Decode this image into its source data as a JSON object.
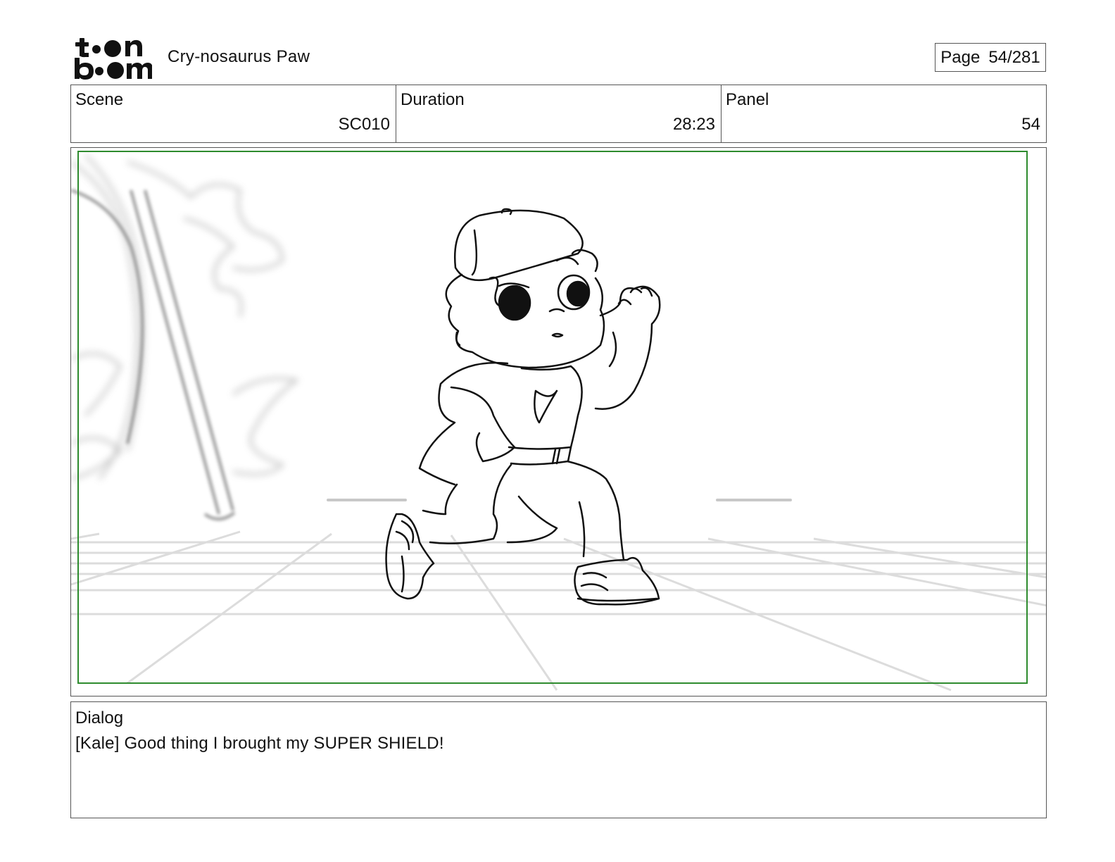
{
  "header": {
    "logo_text": "toon boom",
    "project_title": "Cry-nosaurus Paw",
    "page_label": "Page",
    "page_value": "54/281"
  },
  "info": {
    "scene_label": "Scene",
    "scene_value": "SC010",
    "duration_label": "Duration",
    "duration_value": "28:23",
    "panel_label": "Panel",
    "panel_value": "54"
  },
  "dialog": {
    "label": "Dialog",
    "text": "[Kale] Good thing I brought my SUPER SHIELD!"
  },
  "colors": {
    "safe_frame": "#2e8b2e",
    "border": "#555555",
    "sketch_ink": "#111111",
    "background_sketch": "#c8c8c8"
  }
}
